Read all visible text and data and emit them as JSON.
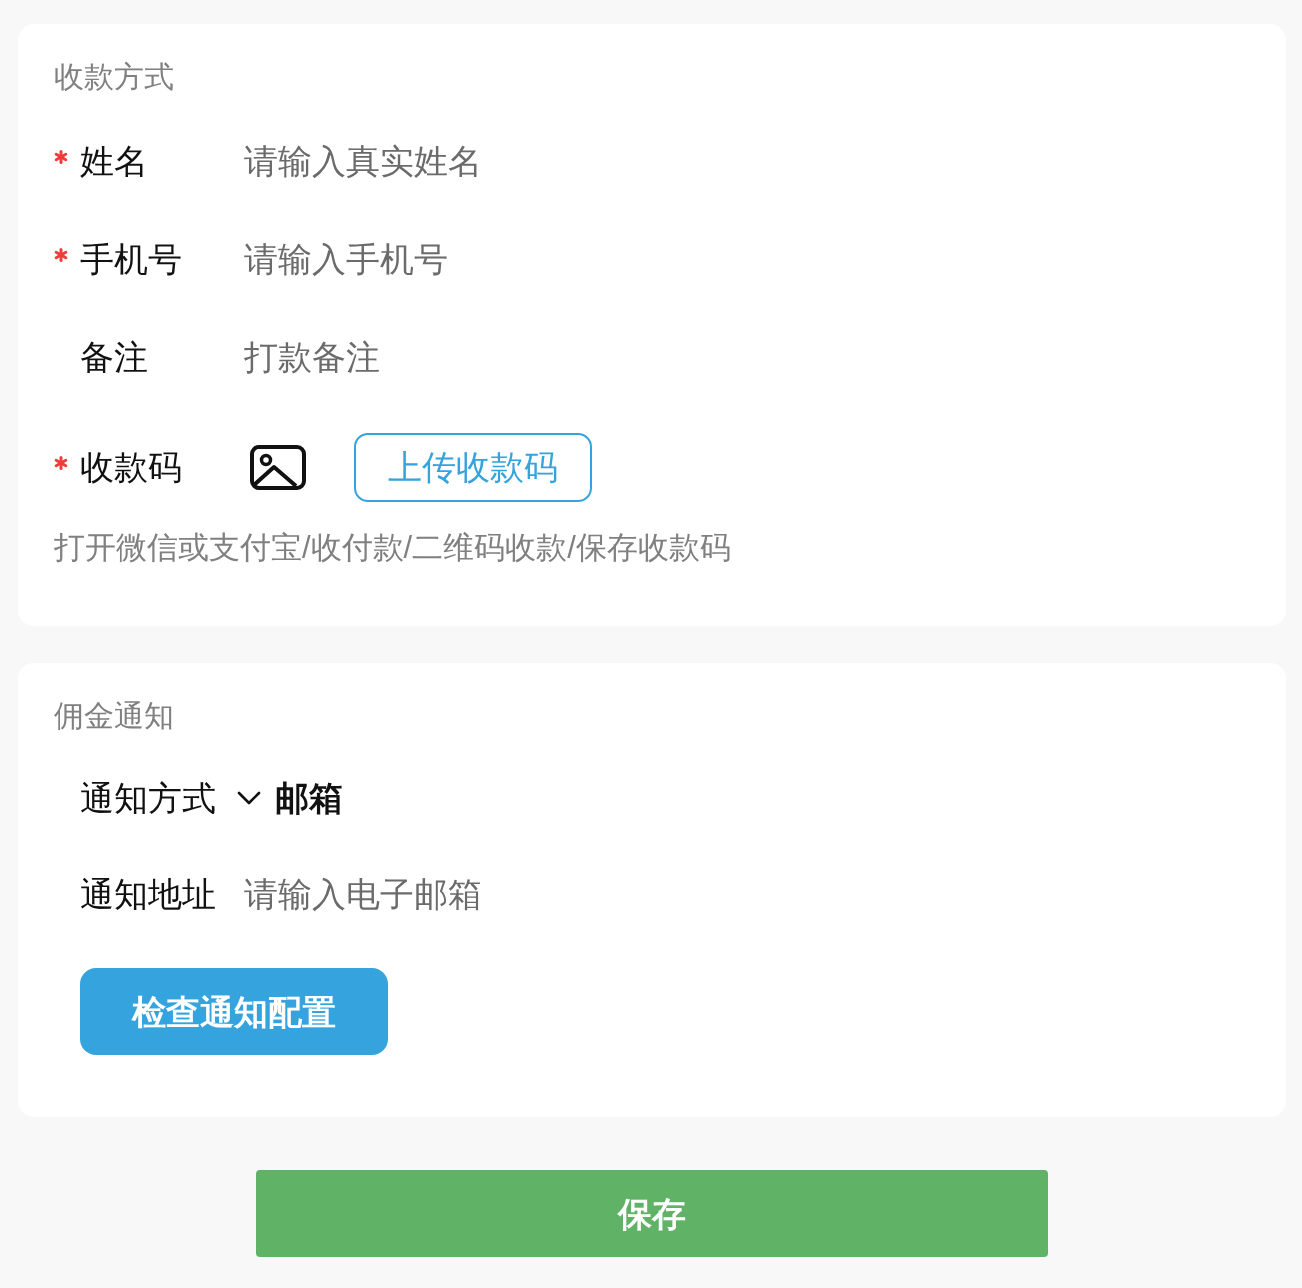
{
  "payment_section": {
    "title": "收款方式",
    "fields": [
      {
        "kind": "input",
        "label": "姓名",
        "required": true,
        "placeholder": "请输入真实姓名"
      },
      {
        "kind": "input",
        "label": "手机号",
        "required": true,
        "placeholder": "请输入手机号"
      },
      {
        "kind": "input",
        "label": "备注",
        "required": false,
        "placeholder": "打款备注"
      },
      {
        "kind": "upload",
        "label": "收款码",
        "required": true,
        "button": "上传收款码"
      }
    ],
    "hint": "打开微信或支付宝/收付款/二维码收款/保存收款码"
  },
  "notification_section": {
    "title": "佣金通知",
    "fields": [
      {
        "kind": "select",
        "label": "通知方式",
        "value": "邮箱"
      },
      {
        "kind": "input",
        "label": "通知地址",
        "placeholder": "请输入电子邮箱"
      }
    ],
    "button": "检查通知配置"
  },
  "save_button": "保存"
}
